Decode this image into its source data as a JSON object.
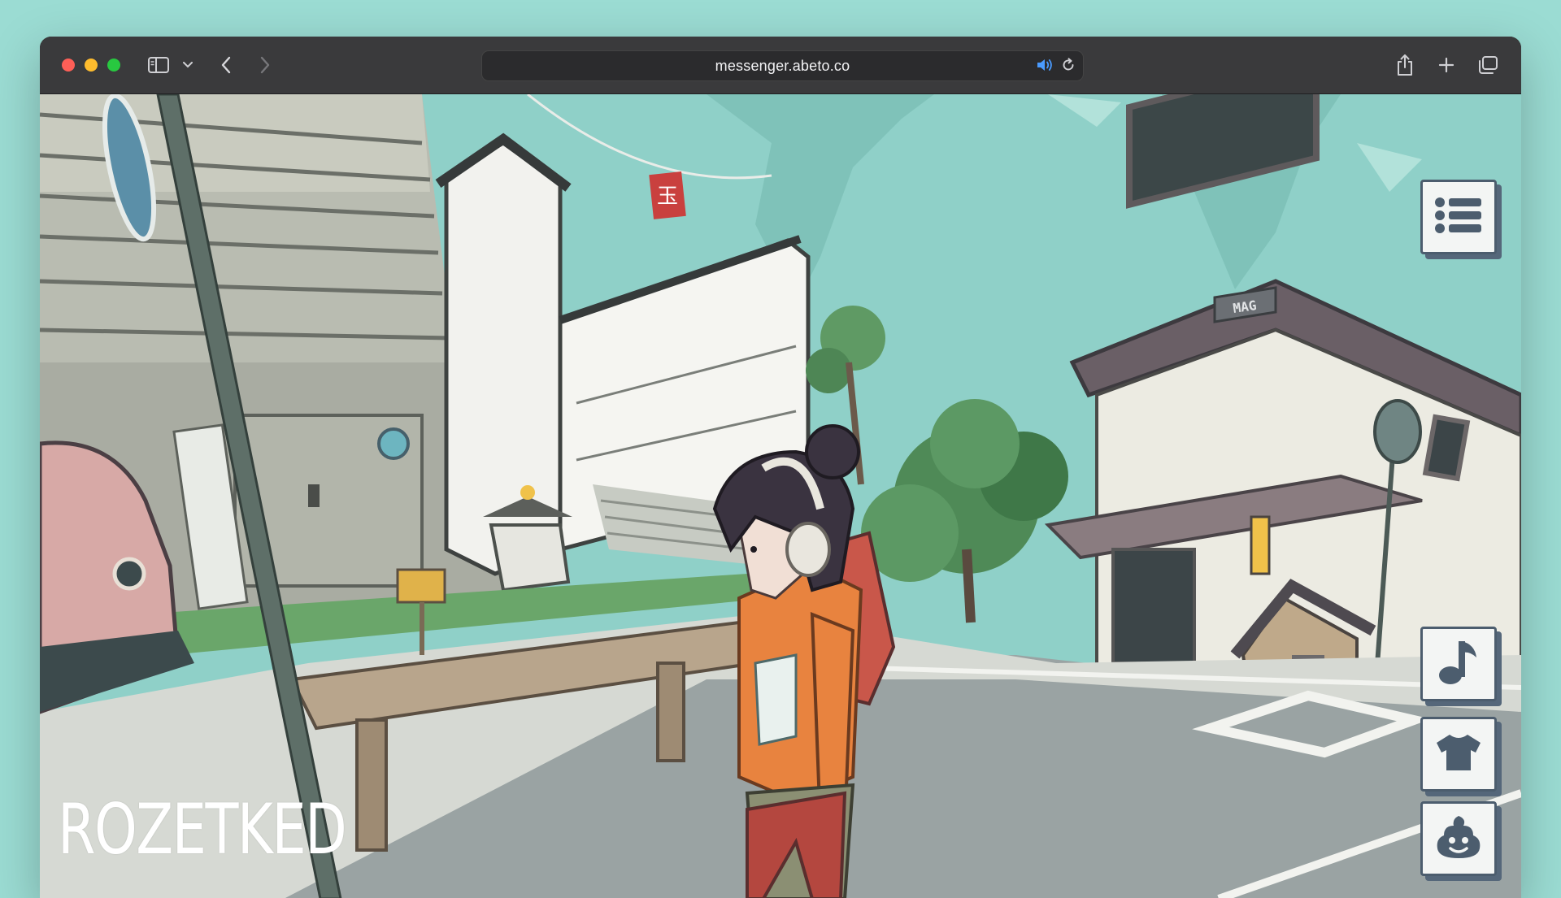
{
  "browser": {
    "url": "messenger.abeto.co",
    "icons": {
      "sidebar": "sidebar-icon",
      "sidebar_dropdown": "chevron-down-icon",
      "back": "chevron-left-icon",
      "forward": "chevron-right-icon",
      "audio": "speaker-icon",
      "reload": "reload-icon",
      "share": "share-icon",
      "new_tab": "plus-icon",
      "tabs": "tabs-overview-icon"
    }
  },
  "game": {
    "watermark": "ROZETKED",
    "buttons": [
      {
        "name": "menu",
        "icon": "list-icon"
      },
      {
        "name": "music",
        "icon": "music-note-icon"
      },
      {
        "name": "outfit",
        "icon": "tshirt-icon"
      },
      {
        "name": "emote",
        "icon": "poop-emoji-icon"
      }
    ],
    "signs": {
      "banner": "玉",
      "shop": "MAG"
    }
  },
  "colors": {
    "sky": "#8fd0c8",
    "chrome": "#3a3a3c",
    "button_border": "#4c5d6e",
    "jacket": "#e8833f",
    "backpack": "#c9574a"
  }
}
